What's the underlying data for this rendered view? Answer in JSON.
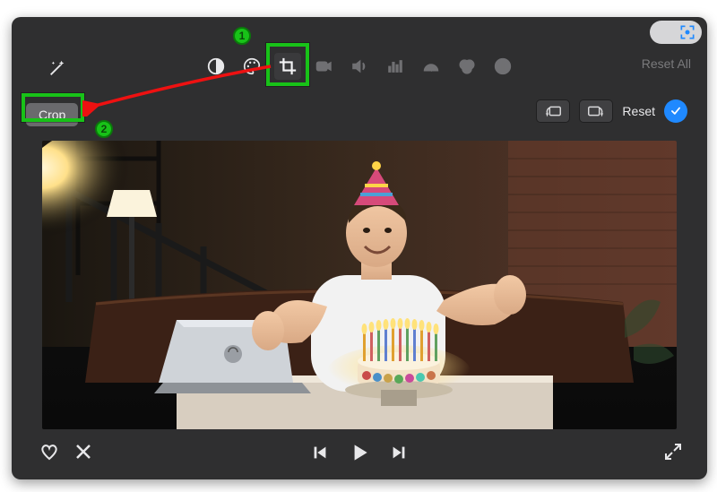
{
  "toolbar": {
    "reset_all": "Reset All",
    "icons": {
      "magic": "magic-wand-icon",
      "balance": "color-balance-icon",
      "palette": "color-palette-icon",
      "crop": "crop-icon",
      "camera": "video-stabilize-icon",
      "volume": "volume-icon",
      "eq": "equalizer-icon",
      "speed": "speedometer-icon",
      "filters": "color-filters-icon",
      "info": "info-icon"
    }
  },
  "crop_row": {
    "crop_label": "Crop",
    "reset_label": "Reset"
  },
  "annotations": {
    "badge1": "1",
    "badge2": "2"
  }
}
